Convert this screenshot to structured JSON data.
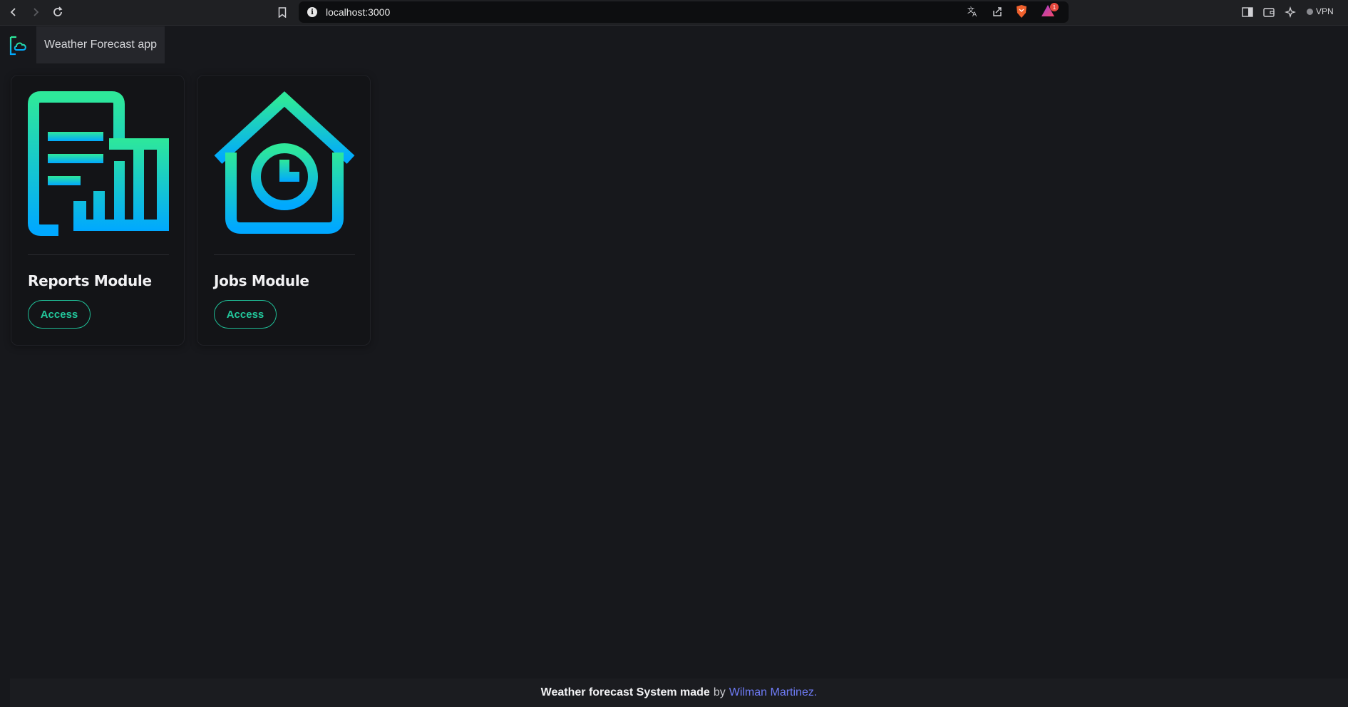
{
  "browser": {
    "url": "localhost:3000",
    "vpn_label": "VPN",
    "rewards_badge": "1"
  },
  "app": {
    "title": "Weather Forecast app"
  },
  "modules": [
    {
      "title": "Reports Module",
      "action_label": "Access",
      "icon": "report-chart-icon"
    },
    {
      "title": "Jobs Module",
      "action_label": "Access",
      "icon": "house-clock-icon"
    }
  ],
  "footer": {
    "prefix": "Weather forecast System made",
    "by": "by",
    "author": "Wilman Martinez",
    "suffix": "."
  },
  "colors": {
    "gradient_top": "#2ee89a",
    "gradient_bottom": "#00a8ff",
    "accent": "#22c79b",
    "link": "#6f7cf7",
    "background": "#17181c"
  }
}
